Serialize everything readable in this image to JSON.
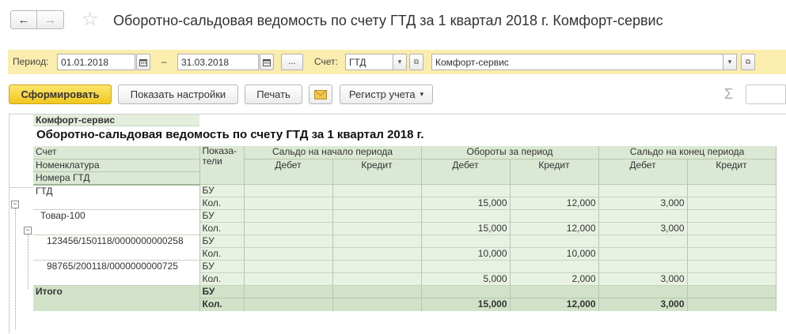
{
  "header": {
    "back_icon": "←",
    "forward_icon": "→",
    "star_icon": "☆",
    "title": "Оборотно-сальдовая ведомость по счету ГТД за 1 квартал 2018 г. Комфорт-сервис"
  },
  "params": {
    "period_label": "Период:",
    "period_from": "01.01.2018",
    "dash": "–",
    "period_to": "31.03.2018",
    "dots_label": "...",
    "account_label": "Счет:",
    "account_value": "ГТД",
    "org_value": "Комфорт-сервис"
  },
  "toolbar": {
    "generate": "Сформировать",
    "show_settings": "Показать настройки",
    "print": "Печать",
    "register": "Регистр учета",
    "sigma": "Σ"
  },
  "report": {
    "org": "Комфорт-сервис",
    "title": "Оборотно-сальдовая ведомость по счету ГТД за 1 квартал 2018 г.",
    "headers": {
      "account": "Счет",
      "nomenclature": "Номенклатура",
      "gtd_numbers": "Номера ГТД",
      "indicators_1": "Показа-",
      "indicators_2": "тели",
      "start_balance": "Сальдо на начало периода",
      "turnover": "Обороты за период",
      "end_balance": "Сальдо на конец периода",
      "debit": "Дебет",
      "credit": "Кредит"
    },
    "rows": [
      {
        "name": "ГТД",
        "ind": "БУ",
        "v": [
          "",
          "",
          "",
          "",
          "",
          ""
        ]
      },
      {
        "name": "",
        "ind": "Кол.",
        "v": [
          "",
          "",
          "15,000",
          "12,000",
          "3,000",
          ""
        ]
      },
      {
        "name": "Товар-100",
        "ind": "БУ",
        "v": [
          "",
          "",
          "",
          "",
          "",
          ""
        ]
      },
      {
        "name": "",
        "ind": "Кол.",
        "v": [
          "",
          "",
          "15,000",
          "12,000",
          "3,000",
          ""
        ]
      },
      {
        "name": "123456/150118/0000000000258",
        "ind": "БУ",
        "v": [
          "",
          "",
          "",
          "",
          "",
          ""
        ]
      },
      {
        "name": "",
        "ind": "Кол.",
        "v": [
          "",
          "",
          "10,000",
          "10,000",
          "",
          ""
        ]
      },
      {
        "name": "98765/200118/0000000000725",
        "ind": "БУ",
        "v": [
          "",
          "",
          "",
          "",
          "",
          ""
        ]
      },
      {
        "name": "",
        "ind": "Кол.",
        "v": [
          "",
          "",
          "5,000",
          "2,000",
          "3,000",
          ""
        ]
      }
    ],
    "total": {
      "name": "Итого",
      "bu": "БУ",
      "qty": "Кол.",
      "v": [
        "",
        "",
        "15,000",
        "12,000",
        "3,000",
        ""
      ]
    }
  }
}
